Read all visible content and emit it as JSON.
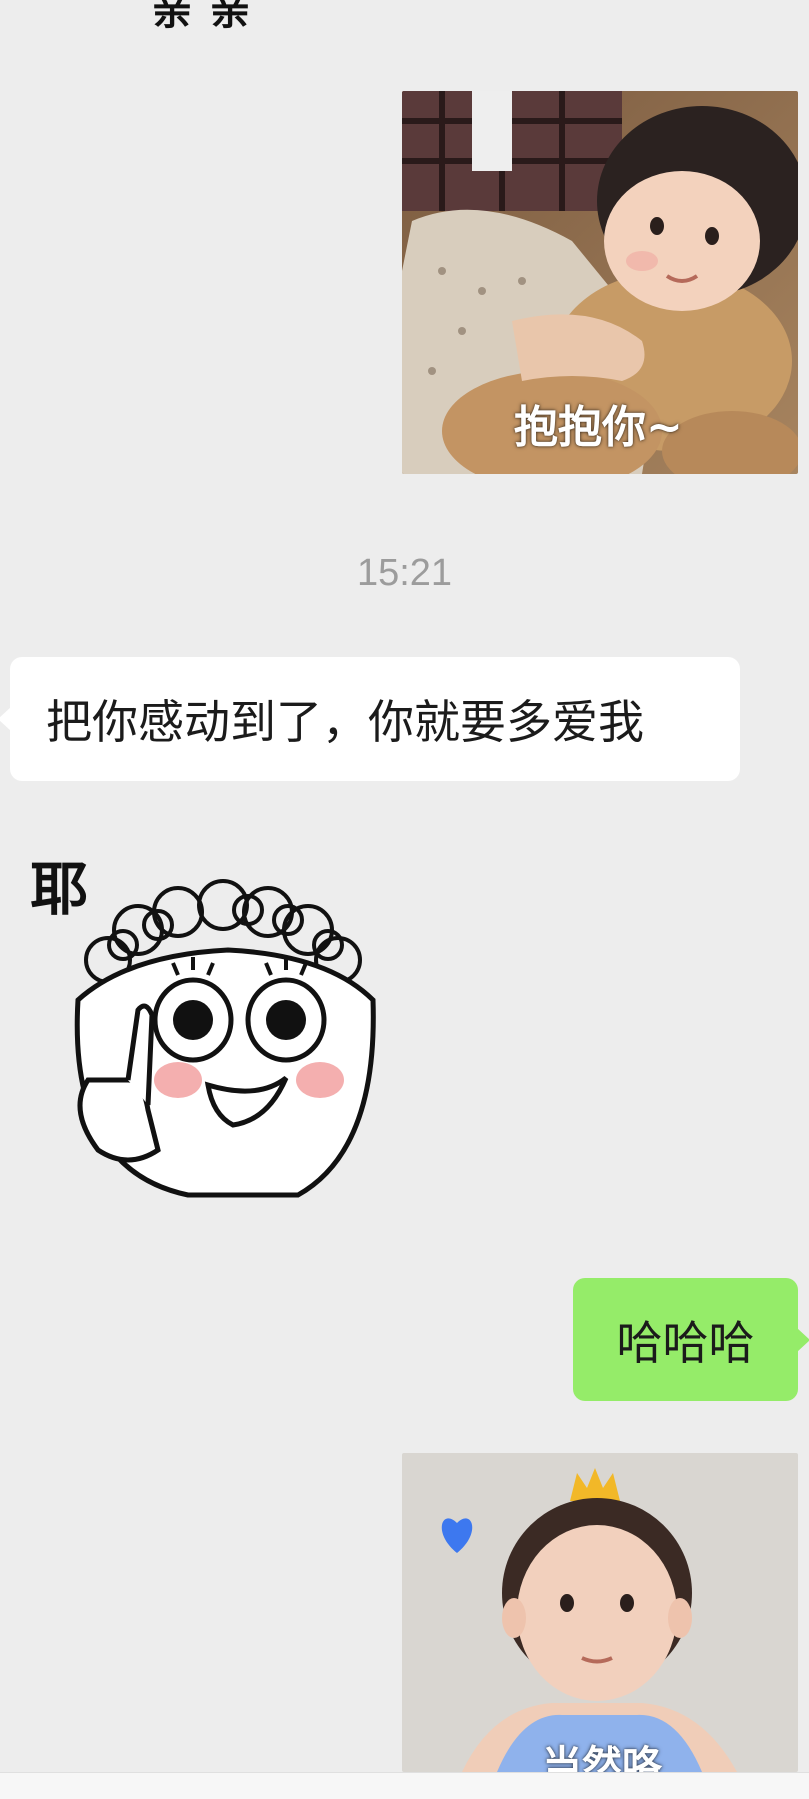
{
  "chat": {
    "top_sticker_text": "亲亲",
    "messages": [
      {
        "type": "image-sticker",
        "side": "right",
        "caption": "抱抱你~"
      },
      {
        "type": "timestamp",
        "text": "15:21"
      },
      {
        "type": "text",
        "side": "left",
        "text": "把你感动到了，你就要多爱我"
      },
      {
        "type": "sticker",
        "side": "left",
        "caption": "耶"
      },
      {
        "type": "text",
        "side": "right",
        "text": "哈哈哈"
      },
      {
        "type": "image-sticker",
        "side": "right",
        "caption": "当然咯"
      }
    ]
  },
  "colors": {
    "background": "#ededed",
    "incoming_bubble": "#ffffff",
    "outgoing_bubble": "#95ec69",
    "timestamp": "#9c9c9c"
  }
}
